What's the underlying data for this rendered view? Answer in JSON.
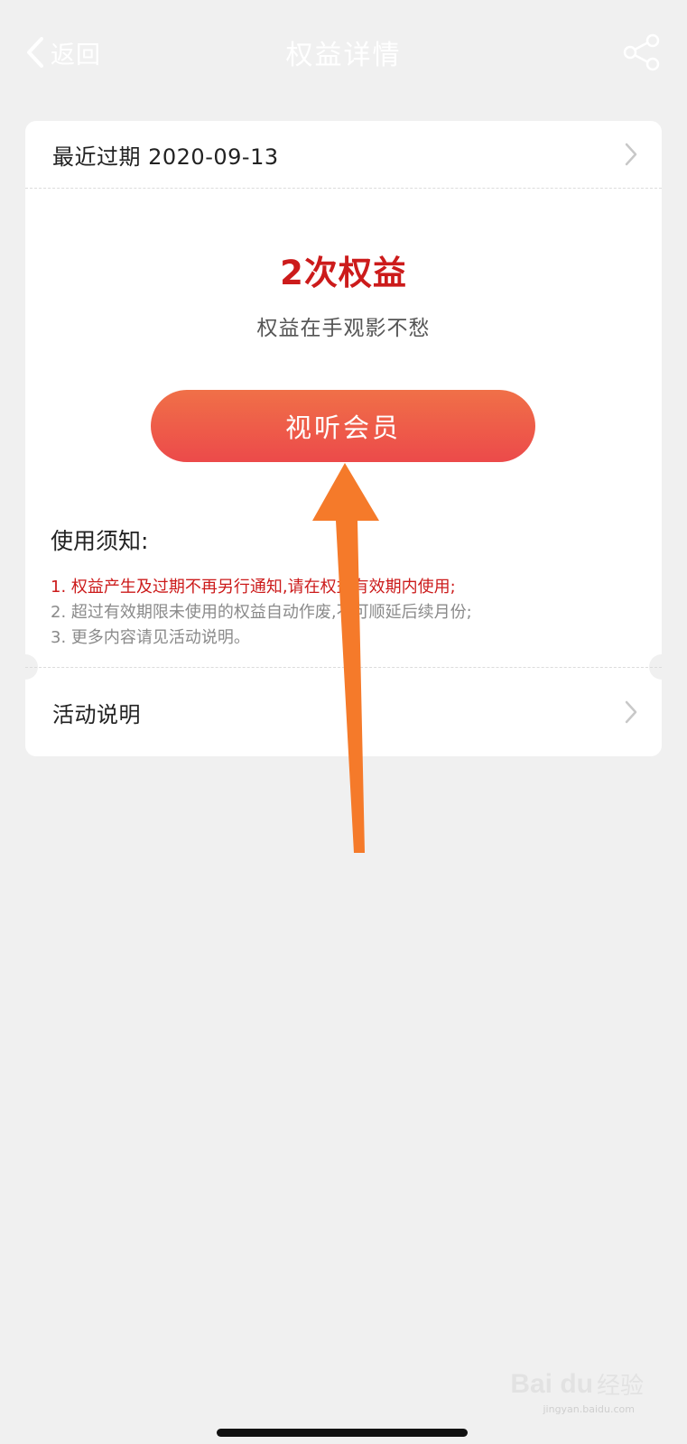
{
  "header": {
    "back_label": "返回",
    "title": "权益详情",
    "share_icon": "share-icon"
  },
  "card": {
    "expiry_row_label": "最近过期 2020-09-13",
    "benefit_count": "2次权益",
    "slogan": "权益在手观影不愁",
    "cta_label": "视听会员",
    "notice_title": "使用须知:",
    "notice_items": [
      "1. 权益产生及过期不再另行通知,请在权益有效期内使用;",
      "2. 超过有效期限未使用的权益自动作废,不可顺延后续月份;",
      "3. 更多内容请见活动说明。"
    ],
    "activity_row_label": "活动说明"
  },
  "watermark": {
    "logo": "Bai du",
    "text": "经验",
    "url": "jingyan.baidu.com"
  },
  "colors": {
    "accent_red": "#cc1b1b",
    "button_gradient_top": "#f07048",
    "button_gradient_bottom": "#ec4a4a",
    "annotation_arrow": "#f57a2a",
    "background": "#f0f0f0"
  }
}
